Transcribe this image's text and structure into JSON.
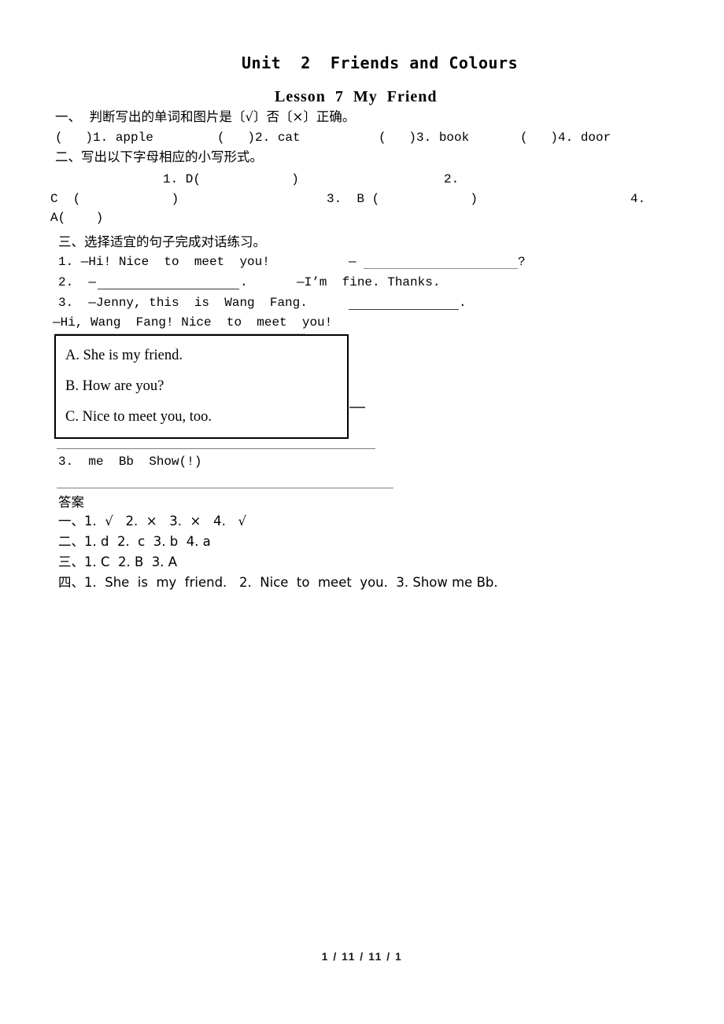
{
  "document": {
    "unit_title": "Unit  2  Friends and Colours",
    "lesson_title": "Lesson  7  My  Friend"
  },
  "section_one": {
    "heading": "一、  判断写出的单词和图片是〔√〕否〔×〕正确。",
    "items": [
      "(   )1. apple",
      "(   )2. cat",
      "(   )3. book",
      "(   )4. door"
    ]
  },
  "section_two": {
    "heading": "二、写出以下字母相应的小写形式。",
    "item1": "1. D(            )",
    "item2_num": "2.",
    "item2_letter": "C  (            )",
    "item3": "3.  B (            )",
    "item4_num": "4.",
    "item4_letter": "A(    )"
  },
  "section_three": {
    "heading": "三、选择适宜的句子完成对话练习。",
    "line1_prefix": "1. —Hi! Nice  to  meet  you!",
    "line1_dash": "—",
    "line1_suffix": "?",
    "line2_prefix": "2.  —",
    "line2_mid": ".",
    "line2_suffix": "—I’m  fine. Thanks.",
    "line3_prefix": "3.  —Jenny, this  is  Wang  Fang.",
    "line3_suffix": ".",
    "line4": "—Hi, Wang  Fang! Nice  to  meet  you!"
  },
  "option_box": {
    "options": [
      "A. She is my friend.",
      "B. How are you?",
      "C. Nice to meet you, too."
    ]
  },
  "section_four": {
    "item3": "3.  me  Bb  Show(!)"
  },
  "answers": {
    "heading": "答案",
    "line1": "一、1.  √   2.  ×   3.  ×   4.   √",
    "line2": "二、1. d  2.  c  3. b  4. a",
    "line3": "三、1. C  2. B  3. A",
    "line4": "四、1.  She  is  my  friend.   2.  Nice  to  meet  you.  3. Show me Bb."
  },
  "footer": {
    "page_indicator": "1 / 11 / 11 / 1"
  }
}
